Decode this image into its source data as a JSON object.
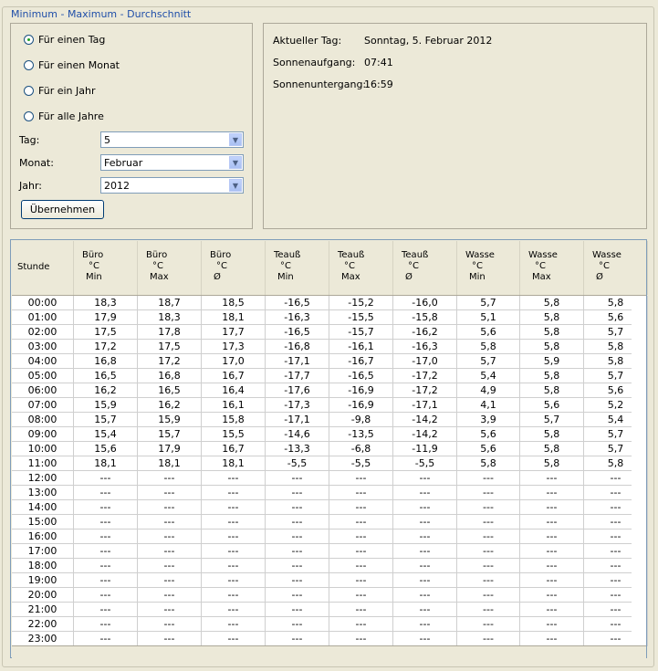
{
  "group_title": "Minimum - Maximum - Durchschnitt",
  "radios": [
    {
      "label": "Für einen Tag",
      "checked": true
    },
    {
      "label": "Für einen Monat",
      "checked": false
    },
    {
      "label": "Für ein Jahr",
      "checked": false
    },
    {
      "label": "Für alle Jahre",
      "checked": false
    }
  ],
  "fields": {
    "tag": {
      "label": "Tag:",
      "value": "5"
    },
    "monat": {
      "label": "Monat:",
      "value": "Februar"
    },
    "jahr": {
      "label": "Jahr:",
      "value": "2012"
    }
  },
  "apply_label": "Übernehmen",
  "info": {
    "current_day_label": "Aktueller Tag:",
    "current_day_value": "Sonntag, 5. Februar 2012",
    "sunrise_label": "Sonnenaufgang:",
    "sunrise_value": "07:41",
    "sunset_label": "Sonnenuntergang:",
    "sunset_value": "16:59"
  },
  "table": {
    "hour_header": "Stunde",
    "columns": [
      {
        "title": "Büro",
        "unit": "°C",
        "stat": "Min"
      },
      {
        "title": "Büro",
        "unit": "°C",
        "stat": "Max"
      },
      {
        "title": "Büro",
        "unit": "°C",
        "stat": "Ø"
      },
      {
        "title": "Teauß",
        "unit": "°C",
        "stat": "Min"
      },
      {
        "title": "Teauß",
        "unit": "°C",
        "stat": "Max"
      },
      {
        "title": "Teauß",
        "unit": "°C",
        "stat": "Ø"
      },
      {
        "title": "Wasse",
        "unit": "°C",
        "stat": "Min"
      },
      {
        "title": "Wasse",
        "unit": "°C",
        "stat": "Max"
      },
      {
        "title": "Wasse",
        "unit": "°C",
        "stat": "Ø"
      }
    ],
    "rows": [
      [
        "00:00",
        "18,3",
        "18,7",
        "18,5",
        "-16,5",
        "-15,2",
        "-16,0",
        "5,7",
        "5,8",
        "5,8"
      ],
      [
        "01:00",
        "17,9",
        "18,3",
        "18,1",
        "-16,3",
        "-15,5",
        "-15,8",
        "5,1",
        "5,8",
        "5,6"
      ],
      [
        "02:00",
        "17,5",
        "17,8",
        "17,7",
        "-16,5",
        "-15,7",
        "-16,2",
        "5,6",
        "5,8",
        "5,7"
      ],
      [
        "03:00",
        "17,2",
        "17,5",
        "17,3",
        "-16,8",
        "-16,1",
        "-16,3",
        "5,8",
        "5,8",
        "5,8"
      ],
      [
        "04:00",
        "16,8",
        "17,2",
        "17,0",
        "-17,1",
        "-16,7",
        "-17,0",
        "5,7",
        "5,9",
        "5,8"
      ],
      [
        "05:00",
        "16,5",
        "16,8",
        "16,7",
        "-17,7",
        "-16,5",
        "-17,2",
        "5,4",
        "5,8",
        "5,7"
      ],
      [
        "06:00",
        "16,2",
        "16,5",
        "16,4",
        "-17,6",
        "-16,9",
        "-17,2",
        "4,9",
        "5,8",
        "5,6"
      ],
      [
        "07:00",
        "15,9",
        "16,2",
        "16,1",
        "-17,3",
        "-16,9",
        "-17,1",
        "4,1",
        "5,6",
        "5,2"
      ],
      [
        "08:00",
        "15,7",
        "15,9",
        "15,8",
        "-17,1",
        "-9,8",
        "-14,2",
        "3,9",
        "5,7",
        "5,4"
      ],
      [
        "09:00",
        "15,4",
        "15,7",
        "15,5",
        "-14,6",
        "-13,5",
        "-14,2",
        "5,6",
        "5,8",
        "5,7"
      ],
      [
        "10:00",
        "15,6",
        "17,9",
        "16,7",
        "-13,3",
        "-6,8",
        "-11,9",
        "5,6",
        "5,8",
        "5,7"
      ],
      [
        "11:00",
        "18,1",
        "18,1",
        "18,1",
        "-5,5",
        "-5,5",
        "-5,5",
        "5,8",
        "5,8",
        "5,8"
      ],
      [
        "12:00",
        "---",
        "---",
        "---",
        "---",
        "---",
        "---",
        "---",
        "---",
        "---"
      ],
      [
        "13:00",
        "---",
        "---",
        "---",
        "---",
        "---",
        "---",
        "---",
        "---",
        "---"
      ],
      [
        "14:00",
        "---",
        "---",
        "---",
        "---",
        "---",
        "---",
        "---",
        "---",
        "---"
      ],
      [
        "15:00",
        "---",
        "---",
        "---",
        "---",
        "---",
        "---",
        "---",
        "---",
        "---"
      ],
      [
        "16:00",
        "---",
        "---",
        "---",
        "---",
        "---",
        "---",
        "---",
        "---",
        "---"
      ],
      [
        "17:00",
        "---",
        "---",
        "---",
        "---",
        "---",
        "---",
        "---",
        "---",
        "---"
      ],
      [
        "18:00",
        "---",
        "---",
        "---",
        "---",
        "---",
        "---",
        "---",
        "---",
        "---"
      ],
      [
        "19:00",
        "---",
        "---",
        "---",
        "---",
        "---",
        "---",
        "---",
        "---",
        "---"
      ],
      [
        "20:00",
        "---",
        "---",
        "---",
        "---",
        "---",
        "---",
        "---",
        "---",
        "---"
      ],
      [
        "21:00",
        "---",
        "---",
        "---",
        "---",
        "---",
        "---",
        "---",
        "---",
        "---"
      ],
      [
        "22:00",
        "---",
        "---",
        "---",
        "---",
        "---",
        "---",
        "---",
        "---",
        "---"
      ],
      [
        "23:00",
        "---",
        "---",
        "---",
        "---",
        "---",
        "---",
        "---",
        "---",
        "---"
      ]
    ]
  }
}
